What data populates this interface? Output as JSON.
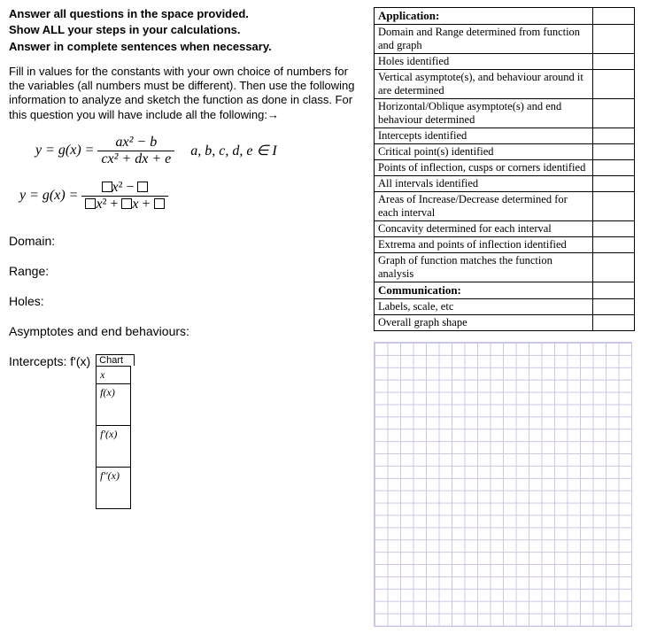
{
  "instructions": {
    "line1": "Answer all questions in the space provided.",
    "line2": "Show ALL your steps in your calculations.",
    "line3": "Answer in complete sentences when necessary.",
    "para": "Fill in values for the constants with your own choice of numbers for the variables (all numbers must be different). Then use the following information to analyze and sketch the function as done in class. For this question you will have include all the following:→"
  },
  "formula1": {
    "lhs": "y = g(x) =",
    "num": "ax² − b",
    "den": "cx² + dx + e",
    "cond": "a, b, c, d, e  ∈  I"
  },
  "formula2": {
    "lhs": "y = g(x) ="
  },
  "fields": {
    "domain": "Domain:",
    "range": "Range:",
    "holes": "Holes:",
    "asymptotes": "Asymptotes and end behaviours:",
    "intercepts": "Intercepts: f'(x)"
  },
  "chart": {
    "caption": "Chart",
    "r1": "x",
    "r2": "f(x)",
    "r3": "f'(x)",
    "r4": "f''(x)"
  },
  "rubric": {
    "header1": "Application:",
    "items1": [
      "Domain and Range determined from function and graph",
      "Holes identified",
      "Vertical asymptote(s), and behaviour around it are determined",
      "Horizontal/Oblique asymptote(s) and end behaviour determined",
      "Intercepts identified",
      "Critical point(s) identified",
      "Points of inflection, cusps or corners identified",
      "All intervals identified",
      "Areas of Increase/Decrease determined for each interval",
      "Concavity determined for each interval",
      "Extrema and points of inflection identified",
      "Graph of function matches the function analysis"
    ],
    "header2": "Communication:",
    "items2": [
      "Labels, scale, etc",
      "Overall graph shape"
    ]
  }
}
